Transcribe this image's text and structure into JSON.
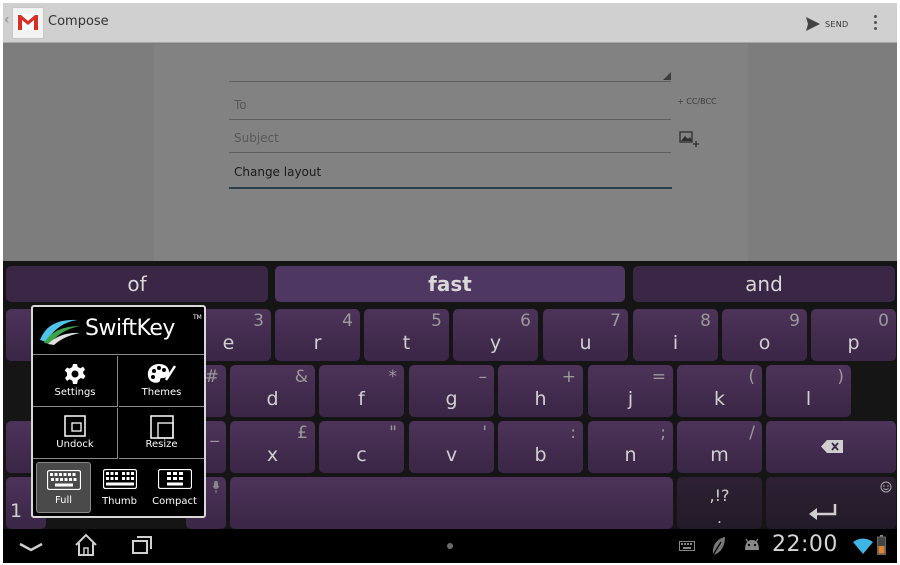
{
  "app": {
    "title": "Compose",
    "logo_icon": "gmail-logo-icon",
    "back_icon": "chevron-left-icon"
  },
  "actionbar": {
    "send_label": "SEND",
    "send_icon": "send-arrow-icon",
    "overflow_icon": "vertical-dots-icon"
  },
  "compose": {
    "from_value": "",
    "to_placeholder": "To",
    "cc_bcc_label": "+ CC/BCC",
    "subject_placeholder": "Subject",
    "attach_icon": "attach-picture-icon",
    "body_text": "Change layout"
  },
  "keyboard": {
    "candidates": [
      "of",
      "fast",
      "and"
    ],
    "rows": [
      [
        {
          "main": "e",
          "sub": "3"
        },
        {
          "main": "r",
          "sub": "4"
        },
        {
          "main": "t",
          "sub": "5"
        },
        {
          "main": "y",
          "sub": "6"
        },
        {
          "main": "u",
          "sub": "7"
        },
        {
          "main": "i",
          "sub": "8"
        },
        {
          "main": "o",
          "sub": "9"
        },
        {
          "main": "p",
          "sub": "0"
        }
      ],
      [
        {
          "main": "",
          "sub": "#"
        },
        {
          "main": "d",
          "sub": "&"
        },
        {
          "main": "f",
          "sub": "*"
        },
        {
          "main": "g",
          "sub": "–"
        },
        {
          "main": "h",
          "sub": "+"
        },
        {
          "main": "j",
          "sub": "="
        },
        {
          "main": "k",
          "sub": "("
        },
        {
          "main": "l",
          "sub": ")"
        }
      ],
      [
        {
          "main": "",
          "sub": "_"
        },
        {
          "main": "x",
          "sub": "£"
        },
        {
          "main": "c",
          "sub": "\""
        },
        {
          "main": "v",
          "sub": "'"
        },
        {
          "main": "b",
          "sub": ":"
        },
        {
          "main": "n",
          "sub": ";"
        },
        {
          "main": "m",
          "sub": "/"
        }
      ],
      [
        {
          "main": "1",
          "sub": ""
        },
        {
          "main": ".",
          "sub": ",!?"
        }
      ]
    ],
    "icons": {
      "backspace": "backspace-icon",
      "mic": "microphone-icon",
      "emoji": "smiley-icon",
      "enter": "enter-arrow-icon"
    }
  },
  "popup": {
    "brand": "SwiftKey",
    "tm": "TM",
    "items": [
      {
        "label": "Settings",
        "icon": "gear-icon"
      },
      {
        "label": "Themes",
        "icon": "palette-icon"
      },
      {
        "label": "Undock",
        "icon": "undock-icon"
      },
      {
        "label": "Resize",
        "icon": "resize-icon"
      }
    ],
    "layouts": [
      {
        "label": "Full",
        "icon": "keyboard-full-icon",
        "selected": true
      },
      {
        "label": "Thumb",
        "icon": "keyboard-thumb-icon",
        "selected": false
      },
      {
        "label": "Compact",
        "icon": "keyboard-compact-icon",
        "selected": false
      }
    ]
  },
  "navbar": {
    "clock": "22:00",
    "icons": [
      "back-icon",
      "home-icon",
      "recent-apps-icon",
      "keyboard-indicator-icon",
      "leaf-icon",
      "android-icon",
      "wifi-icon",
      "battery-icon"
    ]
  },
  "colors": {
    "key_purple": "#4d3359",
    "candidate_bar": "#3a2745",
    "action_bar": "#d0d0d0",
    "field_underline_active": "#2a3d4a",
    "gmail_red": "#d93025"
  }
}
